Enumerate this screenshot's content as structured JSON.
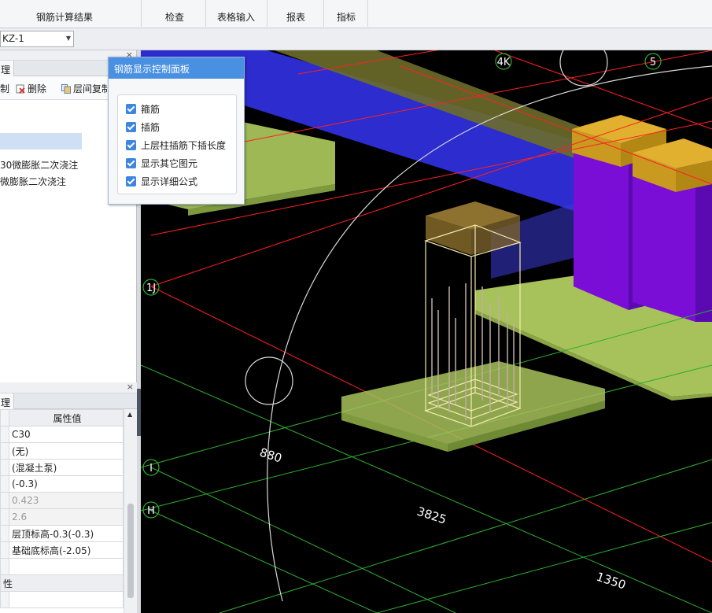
{
  "ribbon": {
    "groups": [
      {
        "label": "钢筋计算结果"
      },
      {
        "label": "检查"
      },
      {
        "label": "表格输入"
      },
      {
        "label": "报表"
      },
      {
        "label": "指标"
      }
    ]
  },
  "selector": {
    "value": "KZ-1"
  },
  "left_panel": {
    "tab_label": "理",
    "toolbar": {
      "item1": "制",
      "delete": "删除",
      "copy": "层间复制"
    },
    "tree_items": [
      "30微膨胀二次浇注",
      "微膨胀二次浇注"
    ]
  },
  "props_panel": {
    "tab_label": "理",
    "column_header": "属性值",
    "rows": [
      {
        "value": "C30",
        "grey": false
      },
      {
        "value": "(无)",
        "grey": false
      },
      {
        "value": "(混凝土泵)",
        "grey": false
      },
      {
        "value": "(-0.3)",
        "grey": false
      },
      {
        "value": "0.423",
        "grey": true
      },
      {
        "value": "2.6",
        "grey": true
      },
      {
        "value": "层顶标高-0.3(-0.3)",
        "grey": false
      },
      {
        "value": "基础底标高(-2.05)",
        "grey": false
      },
      {
        "value": "",
        "grey": false
      }
    ],
    "section_label": "性"
  },
  "rebar_panel": {
    "title": "钢筋显示控制面板",
    "options": [
      {
        "label": "箍筋",
        "checked": true
      },
      {
        "label": "插筋",
        "checked": true
      },
      {
        "label": "上层柱插筋下插长度",
        "checked": true
      },
      {
        "label": "显示其它图元",
        "checked": true
      },
      {
        "label": "显示详细公式",
        "checked": true
      }
    ]
  },
  "viewport": {
    "axis_labels": [
      "4K",
      "5",
      "1J",
      "I",
      "H"
    ],
    "dimensions": [
      "880",
      "3825",
      "1350"
    ]
  },
  "colors": {
    "panel_title": "#4a90e2",
    "checkbox": "#3b86e0",
    "beam_blue": "#2c2ccf",
    "column_purple": "#7a0ed6",
    "column_cap": "#e0b02e",
    "slab_olive": "#a7c25a",
    "axis_red": "#ff2020",
    "grid_green": "#2fae2f"
  }
}
